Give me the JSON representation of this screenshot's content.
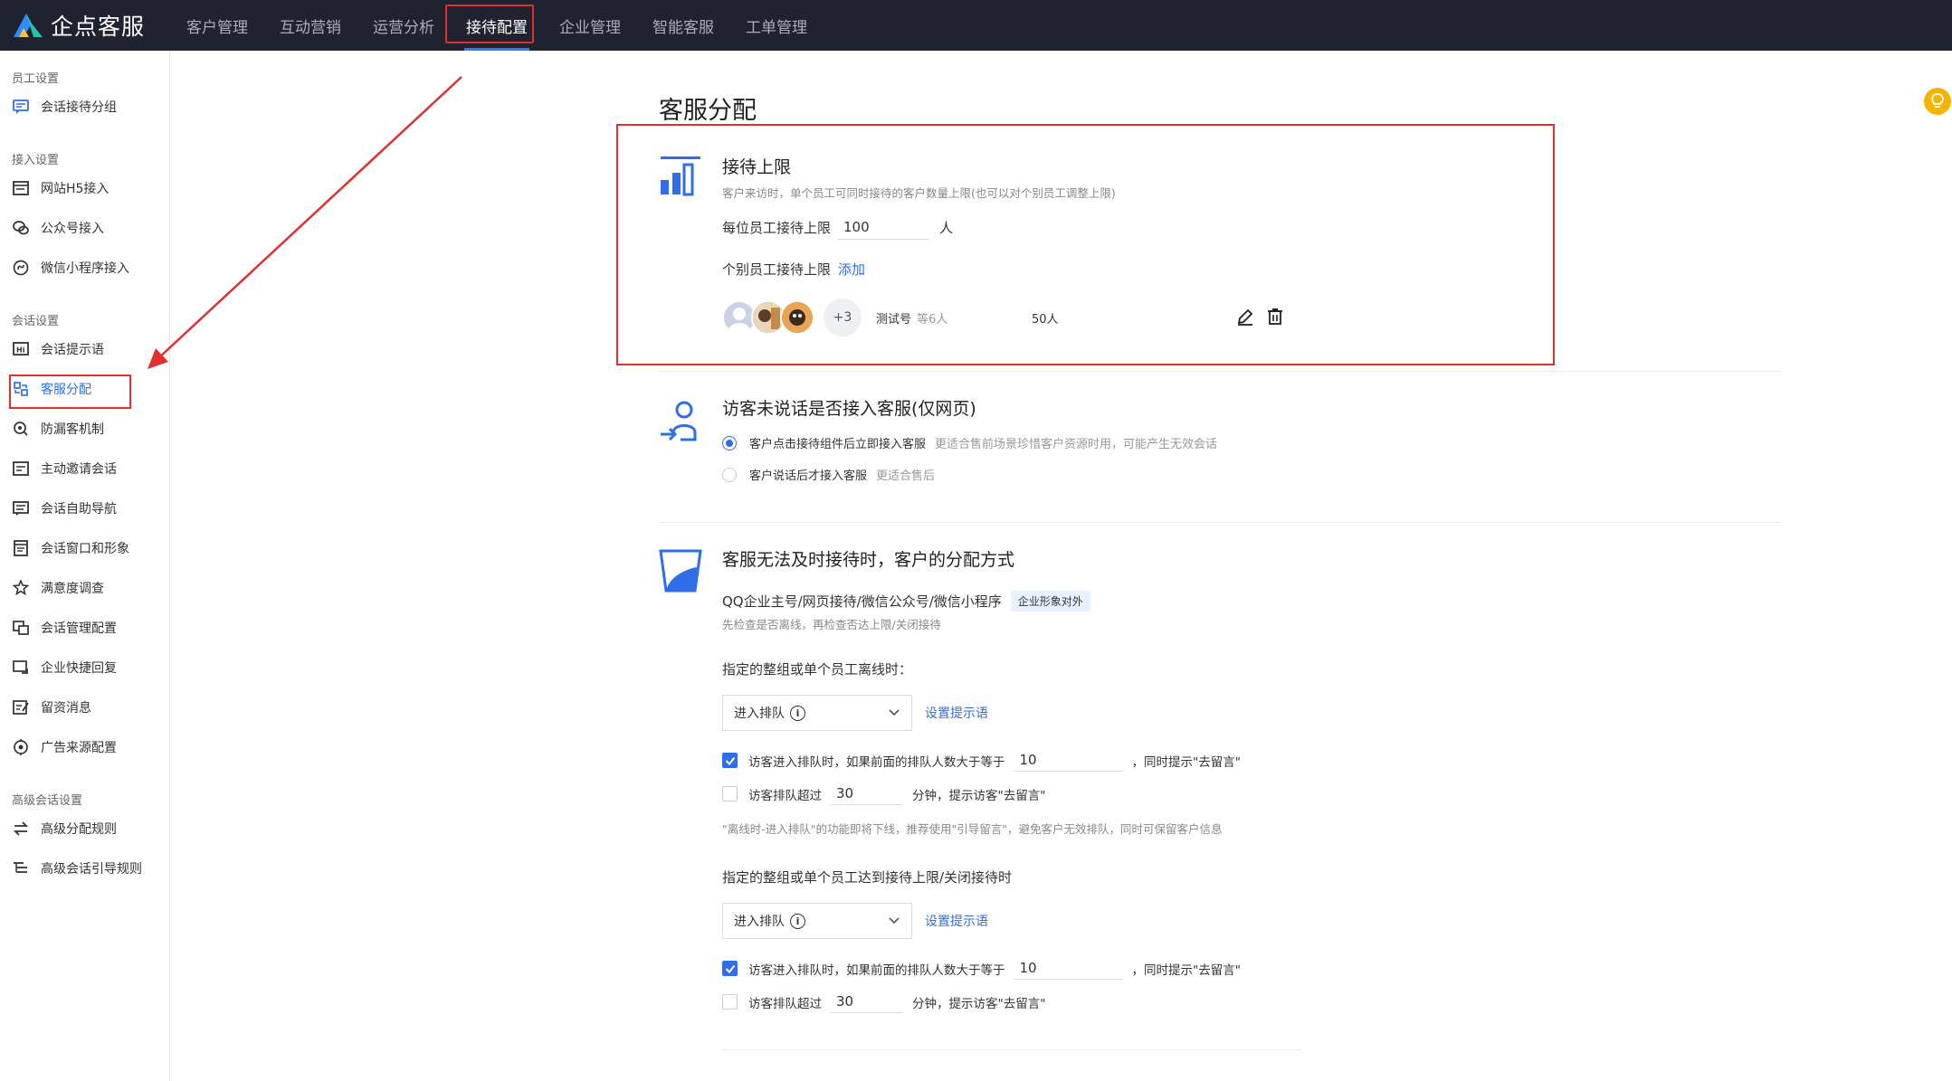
{
  "app": {
    "name": "企点客服"
  },
  "nav": [
    {
      "label": "客户管理"
    },
    {
      "label": "互动营销"
    },
    {
      "label": "运营分析"
    },
    {
      "label": "接待配置"
    },
    {
      "label": "企业管理"
    },
    {
      "label": "智能客服"
    },
    {
      "label": "工单管理"
    }
  ],
  "sidebar": {
    "sections": [
      {
        "title": "员工设置",
        "items": [
          {
            "label": "会话接待分组",
            "icon": "chat-group-icon"
          }
        ]
      },
      {
        "title": "接入设置",
        "items": [
          {
            "label": "网站H5接入",
            "icon": "web-icon"
          },
          {
            "label": "公众号接入",
            "icon": "wechat-icon"
          },
          {
            "label": "微信小程序接入",
            "icon": "miniprogram-icon"
          }
        ]
      },
      {
        "title": "会话设置",
        "items": [
          {
            "label": "会话提示语",
            "icon": "hi-icon"
          },
          {
            "label": "客服分配",
            "icon": "assign-icon"
          },
          {
            "label": "防漏客机制",
            "icon": "guard-icon"
          },
          {
            "label": "主动邀请会话",
            "icon": "invite-icon"
          },
          {
            "label": "会话自助导航",
            "icon": "nav-icon"
          },
          {
            "label": "会话窗口和形象",
            "icon": "window-icon"
          },
          {
            "label": "满意度调查",
            "icon": "survey-icon"
          },
          {
            "label": "会话管理配置",
            "icon": "manage-icon"
          },
          {
            "label": "企业快捷回复",
            "icon": "reply-icon"
          },
          {
            "label": "留资消息",
            "icon": "form-icon"
          },
          {
            "label": "广告来源配置",
            "icon": "ad-icon"
          }
        ]
      },
      {
        "title": "高级会话设置",
        "items": [
          {
            "label": "高级分配规则",
            "icon": "rule-icon"
          },
          {
            "label": "高级会话引导规则",
            "icon": "guide-icon"
          }
        ]
      }
    ]
  },
  "page": {
    "title": "客服分配",
    "limit": {
      "title": "接待上限",
      "desc": "客户来访时，单个员工可同时接待的客户数量上限(也可以对个别员工调整上限)",
      "per_label": "每位员工接待上限",
      "per_value": "100",
      "per_unit": "人",
      "individual_label": "个别员工接待上限",
      "add_link": "添加",
      "group": {
        "more": "+3",
        "name": "测试号",
        "count": "等6人",
        "limit": "50人"
      }
    },
    "silent": {
      "title": "访客未说话是否接入客服(仅网页)",
      "options": [
        {
          "label": "客户点击接待组件后立即接入客服",
          "hint": "更适合售前场景珍惜客户资源时用，可能产生无效会话",
          "selected": true
        },
        {
          "label": "客户说话后才接入客服",
          "hint": "更适合售后",
          "selected": false
        }
      ]
    },
    "busy": {
      "title": "客服无法及时接待时，客户的分配方式",
      "channel": "QQ企业主号/网页接待/微信公众号/微信小程序",
      "tag": "企业形象对外",
      "desc": "先检查是否离线，再检查否达上限/关闭接待",
      "offline": {
        "heading": "指定的整组或单个员工离线时：",
        "select": "进入排队",
        "set_tip": "设置提示语",
        "queue_check_pre": "访客进入排队时，如果前面的排队人数大于等于",
        "queue_value": "10",
        "queue_check_post": "，同时提示\"去留言\"",
        "queue_checked": true,
        "wait_pre": "访客排队超过",
        "wait_value": "30",
        "wait_post": "分钟，提示访客\"去留言\"",
        "wait_checked": false,
        "note": "\"离线时-进入排队\"的功能即将下线，推荐使用\"引导留言\"，避免客户无效排队，同时可保留客户信息"
      },
      "full": {
        "heading": "指定的整组或单个员工达到接待上限/关闭接待时",
        "select": "进入排队",
        "set_tip": "设置提示语",
        "queue_check_pre": "访客进入排队时，如果前面的排队人数大于等于",
        "queue_value": "10",
        "queue_check_post": "，同时提示\"去留言\"",
        "queue_checked": true,
        "wait_pre": "访客排队超过",
        "wait_value": "30",
        "wait_post": "分钟，提示访客\"去留言\"",
        "wait_checked": false
      }
    }
  },
  "colors": {
    "accent": "#2f6ee8",
    "annotation": "#e03030",
    "topbar": "#1f2330"
  }
}
